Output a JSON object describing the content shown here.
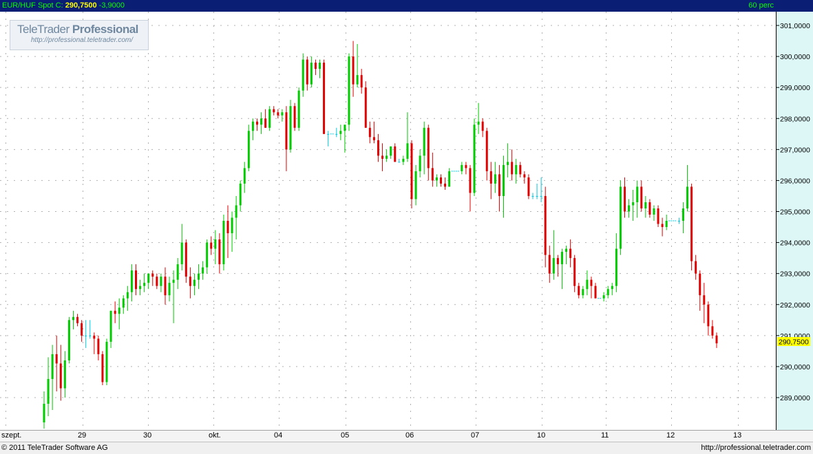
{
  "header": {
    "instrument": "EUR/HUF Spot",
    "close_label": "C:",
    "close_value": "290,7500",
    "change": "-3,9000",
    "period": "60 perc"
  },
  "logo": {
    "brand": "TeleTrader",
    "product": "Professional",
    "url": "http://professional.teletrader.com/"
  },
  "footer": {
    "copyright": "© 2011 TeleTrader Software AG",
    "url": "http://professional.teletrader.com"
  },
  "colors": {
    "up": "#00cc00",
    "down": "#e00000",
    "flat": "#00c8e0",
    "axis_bg": "#ddf7f7",
    "last_price_bg": "#ffff00"
  },
  "chart_data": {
    "type": "candlestick",
    "y_ticks": [
      "301,0000",
      "300,0000",
      "299,0000",
      "298,0000",
      "297,0000",
      "296,0000",
      "295,0000",
      "294,0000",
      "293,0000",
      "292,0000",
      "291,0000",
      "290,0000",
      "289,0000"
    ],
    "last_price_label": "290,7500",
    "x_labels": [
      "szept.",
      "29",
      "30",
      "okt.",
      "04",
      "05",
      "06",
      "07",
      "10",
      "11",
      "12",
      "13"
    ],
    "ylim": [
      288.2,
      301.35
    ],
    "grid": true,
    "series": [
      {
        "o": 288.2,
        "h": 289.2,
        "l": 288.0,
        "c": 288.8
      },
      {
        "o": 288.8,
        "h": 290.3,
        "l": 288.4,
        "c": 289.6
      },
      {
        "o": 289.6,
        "h": 290.7,
        "l": 288.6,
        "c": 290.4
      },
      {
        "o": 290.4,
        "h": 291.0,
        "l": 289.2,
        "c": 290.1
      },
      {
        "o": 290.1,
        "h": 290.7,
        "l": 288.9,
        "c": 289.3
      },
      {
        "o": 289.3,
        "h": 290.5,
        "l": 289.0,
        "c": 290.2
      },
      {
        "o": 290.2,
        "h": 291.6,
        "l": 290.1,
        "c": 291.5
      },
      {
        "o": 291.5,
        "h": 291.8,
        "l": 291.2,
        "c": 291.6
      },
      {
        "o": 291.6,
        "h": 291.7,
        "l": 291.3,
        "c": 291.4
      },
      {
        "o": 291.4,
        "h": 291.5,
        "l": 290.8,
        "c": 291.0
      },
      {
        "o": 291.0,
        "h": 291.5,
        "l": 290.6,
        "c": 291.0
      },
      {
        "o": 291.0,
        "h": 291.5,
        "l": 290.9,
        "c": 291.0
      },
      {
        "o": 291.0,
        "h": 291.1,
        "l": 290.4,
        "c": 290.9
      },
      {
        "o": 290.9,
        "h": 291.0,
        "l": 290.2,
        "c": 290.4
      },
      {
        "o": 290.4,
        "h": 290.5,
        "l": 289.4,
        "c": 289.5
      },
      {
        "o": 289.5,
        "h": 290.9,
        "l": 289.4,
        "c": 290.8
      },
      {
        "o": 290.8,
        "h": 291.8,
        "l": 290.6,
        "c": 291.8
      },
      {
        "o": 291.8,
        "h": 292.1,
        "l": 291.4,
        "c": 291.7
      },
      {
        "o": 291.7,
        "h": 292.2,
        "l": 291.2,
        "c": 291.9
      },
      {
        "o": 291.9,
        "h": 292.3,
        "l": 291.7,
        "c": 292.2
      },
      {
        "o": 292.2,
        "h": 292.6,
        "l": 291.8,
        "c": 292.4
      },
      {
        "o": 292.4,
        "h": 293.3,
        "l": 292.1,
        "c": 293.1
      },
      {
        "o": 293.1,
        "h": 293.3,
        "l": 292.3,
        "c": 292.5
      },
      {
        "o": 292.5,
        "h": 292.8,
        "l": 292.3,
        "c": 292.6
      },
      {
        "o": 292.6,
        "h": 293.0,
        "l": 292.4,
        "c": 292.7
      },
      {
        "o": 292.7,
        "h": 293.0,
        "l": 292.5,
        "c": 293.0
      },
      {
        "o": 293.0,
        "h": 293.1,
        "l": 292.6,
        "c": 292.9
      },
      {
        "o": 292.9,
        "h": 293.0,
        "l": 292.5,
        "c": 292.6
      },
      {
        "o": 292.6,
        "h": 293.0,
        "l": 292.4,
        "c": 292.9
      },
      {
        "o": 292.9,
        "h": 293.2,
        "l": 292.0,
        "c": 292.3
      },
      {
        "o": 292.3,
        "h": 292.9,
        "l": 292.1,
        "c": 292.7
      },
      {
        "o": 292.7,
        "h": 293.1,
        "l": 291.4,
        "c": 292.8
      },
      {
        "o": 292.8,
        "h": 293.5,
        "l": 292.5,
        "c": 293.3
      },
      {
        "o": 293.3,
        "h": 294.6,
        "l": 293.1,
        "c": 294.0
      },
      {
        "o": 294.0,
        "h": 294.1,
        "l": 292.7,
        "c": 292.9
      },
      {
        "o": 292.9,
        "h": 293.2,
        "l": 292.2,
        "c": 292.6
      },
      {
        "o": 292.6,
        "h": 293.0,
        "l": 292.3,
        "c": 292.8
      },
      {
        "o": 292.8,
        "h": 293.3,
        "l": 292.5,
        "c": 293.0
      },
      {
        "o": 293.0,
        "h": 293.4,
        "l": 292.8,
        "c": 293.2
      },
      {
        "o": 293.2,
        "h": 294.1,
        "l": 293.0,
        "c": 294.0
      },
      {
        "o": 294.0,
        "h": 294.2,
        "l": 293.6,
        "c": 293.8
      },
      {
        "o": 293.8,
        "h": 294.4,
        "l": 293.3,
        "c": 294.1
      },
      {
        "o": 294.1,
        "h": 294.3,
        "l": 293.0,
        "c": 293.3
      },
      {
        "o": 293.3,
        "h": 294.9,
        "l": 293.1,
        "c": 294.7
      },
      {
        "o": 294.7,
        "h": 295.2,
        "l": 293.5,
        "c": 294.3
      },
      {
        "o": 294.3,
        "h": 295.0,
        "l": 293.7,
        "c": 294.8
      },
      {
        "o": 294.8,
        "h": 295.5,
        "l": 294.1,
        "c": 295.2
      },
      {
        "o": 295.2,
        "h": 296.0,
        "l": 295.0,
        "c": 295.9
      },
      {
        "o": 295.9,
        "h": 296.6,
        "l": 295.6,
        "c": 296.4
      },
      {
        "o": 296.4,
        "h": 297.8,
        "l": 296.3,
        "c": 297.6
      },
      {
        "o": 297.6,
        "h": 298.0,
        "l": 297.3,
        "c": 297.9
      },
      {
        "o": 297.9,
        "h": 298.0,
        "l": 297.6,
        "c": 297.8
      },
      {
        "o": 297.8,
        "h": 298.2,
        "l": 297.5,
        "c": 298.0
      },
      {
        "o": 298.0,
        "h": 298.3,
        "l": 297.7,
        "c": 297.7
      },
      {
        "o": 297.7,
        "h": 298.4,
        "l": 297.6,
        "c": 298.3
      },
      {
        "o": 298.3,
        "h": 298.4,
        "l": 298.1,
        "c": 298.2
      },
      {
        "o": 298.2,
        "h": 298.3,
        "l": 298.0,
        "c": 298.1
      },
      {
        "o": 298.1,
        "h": 298.3,
        "l": 297.9,
        "c": 298.2
      },
      {
        "o": 298.2,
        "h": 298.4,
        "l": 296.3,
        "c": 297.0
      },
      {
        "o": 297.0,
        "h": 298.6,
        "l": 296.9,
        "c": 298.4
      },
      {
        "o": 298.4,
        "h": 298.5,
        "l": 297.6,
        "c": 297.7
      },
      {
        "o": 297.7,
        "h": 299.0,
        "l": 297.6,
        "c": 298.9
      },
      {
        "o": 298.9,
        "h": 300.1,
        "l": 298.7,
        "c": 299.9
      },
      {
        "o": 299.9,
        "h": 300.0,
        "l": 298.9,
        "c": 299.1
      },
      {
        "o": 299.1,
        "h": 300.0,
        "l": 299.0,
        "c": 299.8
      },
      {
        "o": 299.8,
        "h": 299.9,
        "l": 299.4,
        "c": 299.6
      },
      {
        "o": 299.6,
        "h": 299.9,
        "l": 299.3,
        "c": 299.8
      },
      {
        "o": 299.8,
        "h": 299.9,
        "l": 297.5,
        "c": 297.5
      },
      {
        "o": 297.5,
        "h": 297.6,
        "l": 297.1,
        "c": 297.5
      },
      {
        "o": 297.5,
        "h": 297.5,
        "l": 297.5,
        "c": 297.5
      },
      {
        "o": 297.5,
        "h": 297.7,
        "l": 297.4,
        "c": 297.5
      },
      {
        "o": 297.5,
        "h": 297.8,
        "l": 297.3,
        "c": 297.6
      },
      {
        "o": 297.6,
        "h": 297.8,
        "l": 296.9,
        "c": 297.8
      },
      {
        "o": 297.8,
        "h": 300.1,
        "l": 297.6,
        "c": 300.0
      },
      {
        "o": 300.0,
        "h": 300.5,
        "l": 298.7,
        "c": 299.1
      },
      {
        "o": 299.1,
        "h": 300.4,
        "l": 299.0,
        "c": 299.4
      },
      {
        "o": 299.4,
        "h": 299.6,
        "l": 298.8,
        "c": 299.0
      },
      {
        "o": 299.0,
        "h": 299.2,
        "l": 297.7,
        "c": 297.7
      },
      {
        "o": 297.7,
        "h": 297.9,
        "l": 297.2,
        "c": 297.4
      },
      {
        "o": 297.4,
        "h": 297.9,
        "l": 297.2,
        "c": 297.3
      },
      {
        "o": 297.3,
        "h": 297.5,
        "l": 296.6,
        "c": 296.8
      },
      {
        "o": 296.8,
        "h": 297.2,
        "l": 296.3,
        "c": 296.7
      },
      {
        "o": 296.7,
        "h": 297.0,
        "l": 296.6,
        "c": 296.8
      },
      {
        "o": 296.8,
        "h": 297.1,
        "l": 296.7,
        "c": 297.1
      },
      {
        "o": 297.1,
        "h": 297.2,
        "l": 296.6,
        "c": 296.6
      },
      {
        "o": 296.6,
        "h": 296.7,
        "l": 296.6,
        "c": 296.6
      },
      {
        "o": 296.6,
        "h": 296.8,
        "l": 296.5,
        "c": 296.7
      },
      {
        "o": 296.7,
        "h": 298.2,
        "l": 296.6,
        "c": 297.2
      },
      {
        "o": 297.2,
        "h": 297.3,
        "l": 295.1,
        "c": 295.4
      },
      {
        "o": 295.4,
        "h": 296.5,
        "l": 295.2,
        "c": 296.3
      },
      {
        "o": 296.3,
        "h": 297.0,
        "l": 296.1,
        "c": 296.8
      },
      {
        "o": 296.8,
        "h": 297.9,
        "l": 296.2,
        "c": 297.7
      },
      {
        "o": 297.7,
        "h": 297.8,
        "l": 296.0,
        "c": 296.4
      },
      {
        "o": 296.4,
        "h": 296.9,
        "l": 295.8,
        "c": 296.0
      },
      {
        "o": 296.0,
        "h": 296.2,
        "l": 295.8,
        "c": 296.1
      },
      {
        "o": 296.1,
        "h": 296.2,
        "l": 295.8,
        "c": 295.9
      },
      {
        "o": 295.9,
        "h": 296.1,
        "l": 295.7,
        "c": 295.8
      },
      {
        "o": 295.8,
        "h": 296.4,
        "l": 295.8,
        "c": 296.3
      },
      {
        "o": 296.3,
        "h": 296.3,
        "l": 296.3,
        "c": 296.3
      },
      {
        "o": 296.3,
        "h": 296.3,
        "l": 296.3,
        "c": 296.3
      },
      {
        "o": 296.3,
        "h": 296.6,
        "l": 296.2,
        "c": 296.5
      },
      {
        "o": 296.5,
        "h": 296.6,
        "l": 296.2,
        "c": 296.4
      },
      {
        "o": 296.4,
        "h": 296.5,
        "l": 295.0,
        "c": 295.6
      },
      {
        "o": 295.6,
        "h": 298.0,
        "l": 295.5,
        "c": 297.8
      },
      {
        "o": 297.8,
        "h": 298.5,
        "l": 297.5,
        "c": 297.9
      },
      {
        "o": 297.9,
        "h": 298.0,
        "l": 297.4,
        "c": 297.6
      },
      {
        "o": 297.6,
        "h": 297.7,
        "l": 296.0,
        "c": 296.3
      },
      {
        "o": 296.3,
        "h": 296.6,
        "l": 295.4,
        "c": 295.9
      },
      {
        "o": 295.9,
        "h": 296.6,
        "l": 295.6,
        "c": 296.2
      },
      {
        "o": 296.2,
        "h": 296.5,
        "l": 295.0,
        "c": 295.5
      },
      {
        "o": 295.5,
        "h": 296.8,
        "l": 294.8,
        "c": 296.5
      },
      {
        "o": 296.5,
        "h": 297.2,
        "l": 296.1,
        "c": 296.6
      },
      {
        "o": 296.6,
        "h": 297.0,
        "l": 296.0,
        "c": 296.2
      },
      {
        "o": 296.2,
        "h": 296.7,
        "l": 295.9,
        "c": 296.5
      },
      {
        "o": 296.5,
        "h": 296.6,
        "l": 296.1,
        "c": 296.2
      },
      {
        "o": 296.2,
        "h": 296.3,
        "l": 295.9,
        "c": 296.1
      },
      {
        "o": 296.1,
        "h": 296.2,
        "l": 295.4,
        "c": 295.5
      },
      {
        "o": 295.5,
        "h": 295.6,
        "l": 295.4,
        "c": 295.5
      },
      {
        "o": 295.5,
        "h": 295.9,
        "l": 295.4,
        "c": 295.5
      },
      {
        "o": 295.5,
        "h": 296.1,
        "l": 295.3,
        "c": 295.5
      },
      {
        "o": 295.5,
        "h": 295.8,
        "l": 293.2,
        "c": 293.6
      },
      {
        "o": 293.6,
        "h": 293.9,
        "l": 292.7,
        "c": 293.0
      },
      {
        "o": 293.0,
        "h": 294.4,
        "l": 292.8,
        "c": 293.5
      },
      {
        "o": 293.5,
        "h": 293.6,
        "l": 292.9,
        "c": 293.3
      },
      {
        "o": 293.3,
        "h": 293.8,
        "l": 292.5,
        "c": 293.7
      },
      {
        "o": 293.7,
        "h": 293.9,
        "l": 293.3,
        "c": 293.8
      },
      {
        "o": 293.8,
        "h": 294.1,
        "l": 293.2,
        "c": 293.5
      },
      {
        "o": 293.5,
        "h": 293.6,
        "l": 292.4,
        "c": 292.6
      },
      {
        "o": 292.6,
        "h": 292.7,
        "l": 292.2,
        "c": 292.3
      },
      {
        "o": 292.3,
        "h": 292.6,
        "l": 292.2,
        "c": 292.5
      },
      {
        "o": 292.5,
        "h": 293.1,
        "l": 292.3,
        "c": 292.8
      },
      {
        "o": 292.8,
        "h": 292.9,
        "l": 292.2,
        "c": 292.6
      },
      {
        "o": 292.6,
        "h": 292.7,
        "l": 292.2,
        "c": 292.2
      },
      {
        "o": 292.2,
        "h": 292.2,
        "l": 292.2,
        "c": 292.2
      },
      {
        "o": 292.2,
        "h": 292.4,
        "l": 292.1,
        "c": 292.3
      },
      {
        "o": 292.3,
        "h": 292.6,
        "l": 292.2,
        "c": 292.5
      },
      {
        "o": 292.5,
        "h": 292.7,
        "l": 292.3,
        "c": 292.6
      },
      {
        "o": 292.6,
        "h": 294.3,
        "l": 292.4,
        "c": 293.8
      },
      {
        "o": 293.8,
        "h": 296.0,
        "l": 293.6,
        "c": 295.8
      },
      {
        "o": 295.8,
        "h": 296.1,
        "l": 294.8,
        "c": 295.0
      },
      {
        "o": 295.0,
        "h": 295.4,
        "l": 294.8,
        "c": 295.2
      },
      {
        "o": 295.2,
        "h": 295.7,
        "l": 294.7,
        "c": 295.3
      },
      {
        "o": 295.3,
        "h": 296.0,
        "l": 294.8,
        "c": 295.8
      },
      {
        "o": 295.8,
        "h": 296.0,
        "l": 295.0,
        "c": 295.1
      },
      {
        "o": 295.1,
        "h": 295.5,
        "l": 294.8,
        "c": 295.3
      },
      {
        "o": 295.3,
        "h": 295.4,
        "l": 294.8,
        "c": 294.9
      },
      {
        "o": 294.9,
        "h": 295.2,
        "l": 294.7,
        "c": 295.1
      },
      {
        "o": 295.1,
        "h": 295.2,
        "l": 294.5,
        "c": 294.6
      },
      {
        "o": 294.6,
        "h": 294.8,
        "l": 294.2,
        "c": 294.5
      },
      {
        "o": 294.5,
        "h": 294.9,
        "l": 294.4,
        "c": 294.7
      },
      {
        "o": 294.7,
        "h": 294.7,
        "l": 294.7,
        "c": 294.7
      },
      {
        "o": 294.7,
        "h": 294.7,
        "l": 294.7,
        "c": 294.7
      },
      {
        "o": 294.7,
        "h": 294.8,
        "l": 294.6,
        "c": 294.7
      },
      {
        "o": 294.7,
        "h": 295.3,
        "l": 294.3,
        "c": 295.1
      },
      {
        "o": 295.1,
        "h": 296.5,
        "l": 295.0,
        "c": 295.8
      },
      {
        "o": 295.8,
        "h": 295.9,
        "l": 293.1,
        "c": 293.4
      },
      {
        "o": 293.4,
        "h": 293.6,
        "l": 292.8,
        "c": 293.0
      },
      {
        "o": 293.0,
        "h": 293.1,
        "l": 291.8,
        "c": 292.3
      },
      {
        "o": 292.3,
        "h": 292.7,
        "l": 291.4,
        "c": 292.0
      },
      {
        "o": 292.0,
        "h": 292.1,
        "l": 291.0,
        "c": 291.3
      },
      {
        "o": 291.3,
        "h": 291.5,
        "l": 290.9,
        "c": 291.0
      },
      {
        "o": 291.0,
        "h": 291.1,
        "l": 290.6,
        "c": 290.75
      }
    ]
  }
}
